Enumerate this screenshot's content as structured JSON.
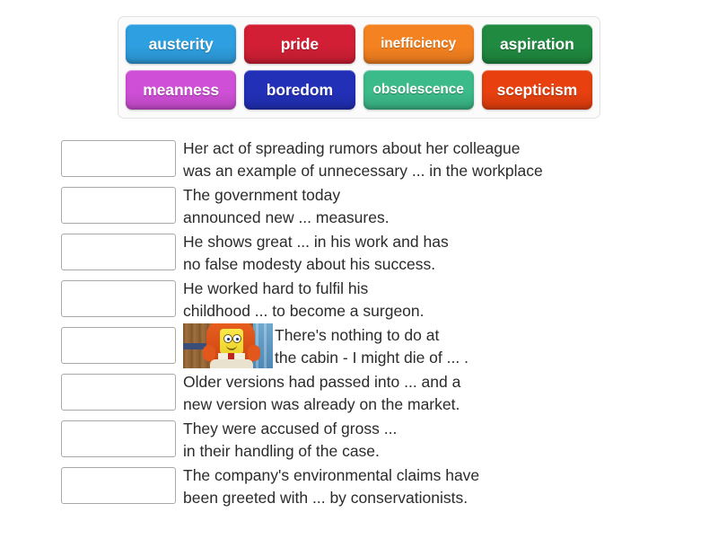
{
  "word_bank": {
    "rows": [
      [
        {
          "label": "austerity",
          "color": "#2e9fe0"
        },
        {
          "label": "pride",
          "color": "#d21f35"
        },
        {
          "label": "inefficiency",
          "color": "#f58220"
        },
        {
          "label": "aspiration",
          "color": "#1f8a40"
        }
      ],
      [
        {
          "label": "meanness",
          "color": "#cf4fd6"
        },
        {
          "label": "boredom",
          "color": "#2230b8"
        },
        {
          "label": "obsolescence",
          "color": "#3cbb8a"
        },
        {
          "label": "scepticism",
          "color": "#e8400f"
        }
      ]
    ]
  },
  "questions": [
    {
      "answer": "",
      "text": "Her act of spreading rumors about her colleague\nwas an example of unnecessary ... in the workplace",
      "has_image": false
    },
    {
      "answer": "",
      "text": "The government today\nannounced new ... measures.",
      "has_image": false
    },
    {
      "answer": "",
      "text": "He shows great ... in his work and has\nno false modesty about his success.",
      "has_image": false
    },
    {
      "answer": "",
      "text": "He worked hard to fulfil his\nchildhood ... to become a surgeon.",
      "has_image": false
    },
    {
      "answer": "",
      "text": "There's nothing to do at\nthe cabin - I might die of ... .",
      "has_image": true,
      "image_name": "spongebob-cabin-thumbnail"
    },
    {
      "answer": "",
      "text": "Older versions had passed into ... and a\nnew version was already on the market.",
      "has_image": false
    },
    {
      "answer": "",
      "text": "They were accused of gross ...\nin their handling of the case.",
      "has_image": false
    },
    {
      "answer": "",
      "text": "The company's environmental claims have\nbeen greeted with ... by conservationists.",
      "has_image": false
    }
  ]
}
